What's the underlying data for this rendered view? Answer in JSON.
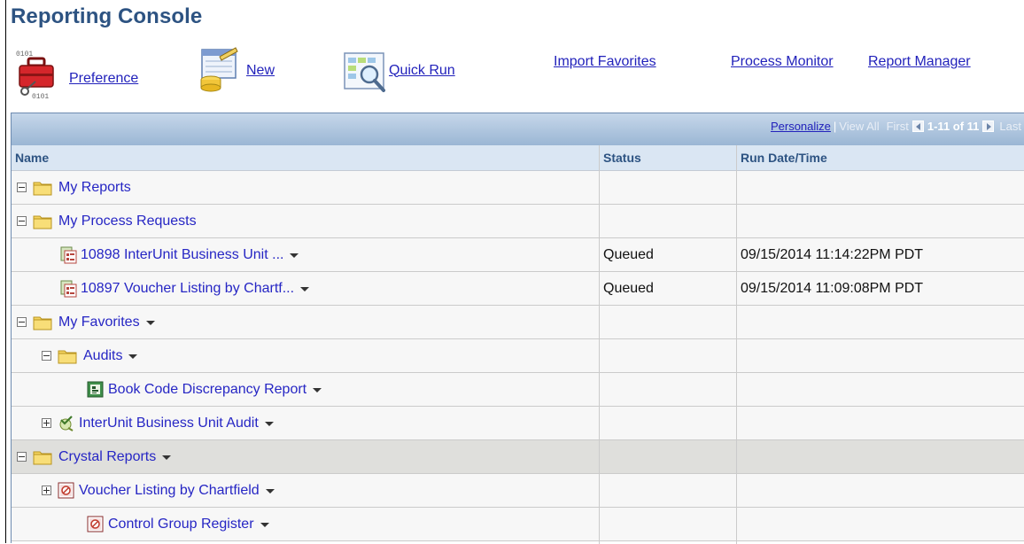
{
  "page": {
    "title": "Reporting Console"
  },
  "toolbar": {
    "preference": {
      "label": "Preference",
      "icon": "toolbox-icon"
    },
    "new": {
      "label": "New",
      "icon": "new-report-icon"
    },
    "quick_run": {
      "label": "Quick Run",
      "icon": "quick-run-icon"
    },
    "import_favorites": "Import Favorites",
    "process_monitor": "Process Monitor",
    "report_manager": "Report Manager"
  },
  "grid": {
    "nav": {
      "personalize": "Personalize",
      "separator": "|",
      "view_all": "View All",
      "first": "First",
      "range": "1-11 of 11",
      "last": "Last"
    },
    "columns": {
      "name": "Name",
      "status": "Status",
      "run_date": "Run Date/Time"
    },
    "rows": [
      {
        "name": "My Reports",
        "type": "folder",
        "level": 0,
        "toggle": "minus",
        "menu": false,
        "status": "",
        "run_date": ""
      },
      {
        "name": "My Process Requests",
        "type": "folder",
        "level": 0,
        "toggle": "minus",
        "menu": false,
        "status": "",
        "run_date": ""
      },
      {
        "name": "10898 InterUnit Business Unit ...",
        "type": "process-request",
        "level": 1,
        "toggle": "none",
        "menu": true,
        "status": "Queued",
        "run_date": "09/15/2014 11:14:22PM PDT"
      },
      {
        "name": "10897 Voucher Listing by Chartf...",
        "type": "process-request",
        "level": 1,
        "toggle": "none",
        "menu": true,
        "status": "Queued",
        "run_date": "09/15/2014 11:09:08PM PDT"
      },
      {
        "name": "My Favorites",
        "type": "folder",
        "level": 0,
        "toggle": "minus",
        "menu": true,
        "status": "",
        "run_date": ""
      },
      {
        "name": "Audits",
        "type": "folder",
        "level": 1,
        "toggle": "minus",
        "menu": true,
        "status": "",
        "run_date": ""
      },
      {
        "name": "Book Code Discrepancy Report",
        "type": "report",
        "level": 2,
        "toggle": "none",
        "menu": true,
        "status": "",
        "run_date": ""
      },
      {
        "name": "InterUnit Business Unit Audit",
        "type": "audit",
        "level": 1,
        "toggle": "plus",
        "menu": true,
        "status": "",
        "run_date": ""
      },
      {
        "name": "Crystal Reports",
        "type": "folder",
        "level": 0,
        "toggle": "minus",
        "menu": true,
        "status": "",
        "run_date": "",
        "highlight": true
      },
      {
        "name": "Voucher Listing by Chartfield",
        "type": "crystal",
        "level": 1,
        "toggle": "plus",
        "menu": true,
        "status": "",
        "run_date": ""
      },
      {
        "name": "Control Group Register",
        "type": "crystal",
        "level": 2,
        "toggle": "none",
        "menu": true,
        "status": "",
        "run_date": ""
      }
    ]
  },
  "colors": {
    "title": "#2d5382",
    "link": "#2222bb",
    "nav_bar_top": "#c6d7ea",
    "nav_bar_bottom": "#9ab6d4",
    "header_bg": "#dae6f3",
    "row_bg": "#f7f7f7",
    "row_highlight": "#dfdfdc",
    "folder": "#f4d460"
  }
}
